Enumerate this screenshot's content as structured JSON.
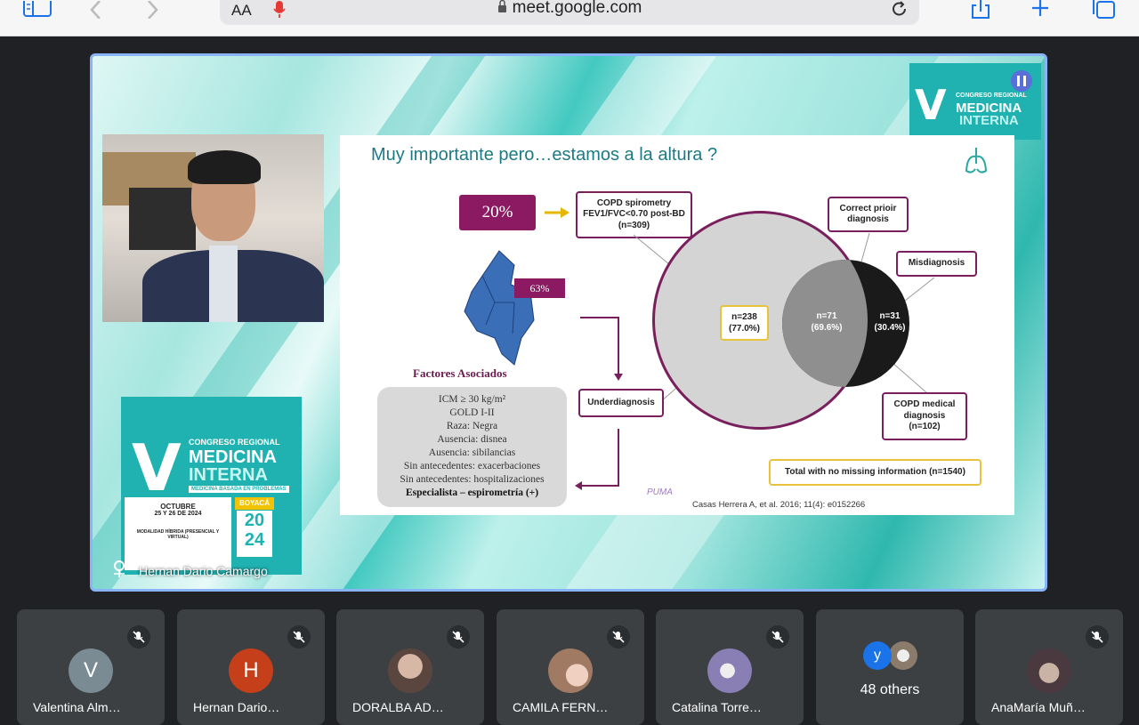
{
  "browser": {
    "text_size_label": "AA",
    "url": "meet.google.com",
    "icons": [
      "sidebar-icon",
      "back-icon",
      "forward-icon",
      "mic-icon",
      "lock-icon",
      "reload-icon",
      "share-icon",
      "new-tab-icon",
      "tabs-icon"
    ]
  },
  "presentation": {
    "slide_title": "Muy importante pero…estamos a la altura  ?",
    "badge_20": "20%",
    "badge_63": "63%",
    "copd_spirometry": "COPD spirometry\nFEV1/FVC<0.70 post-BD\n(n=309)",
    "correct_prior": "Correct prioir\ndiagnosis",
    "misdiagnosis": "Misdiagnosis",
    "underdiagnosis": "Underdiagnosis",
    "copd_medical": "COPD medical\ndiagnosis\n(n=102)",
    "n238": "n=238\n(77.0%)",
    "n71": "n=71\n(69.6%)",
    "n31": "n=31\n(30.4%)",
    "total": "Total with no missing information (n=1540)",
    "factors_title": "Factores Asociados",
    "factors": [
      "ICM ≥ 30 kg/m²",
      "GOLD I-II",
      "Raza: Negra",
      "Ausencia: disnea",
      "Ausencia: sibilancias",
      "Sin antecedentes: exacerbaciones",
      "Sin antecedentes: hospitalizaciones"
    ],
    "factors_last": "Especialista – espirometría (+)",
    "puma": "PUMA",
    "citation": "Casas Herrera A, et al. 2016; 11(4): e0152266",
    "congress_v": "V",
    "congress_line1": "CONGRESO REGIONAL",
    "congress_line2": "MEDICINA",
    "congress_line3": "INTERNA",
    "congress_sub": "MEDICINA BASADA EN PROBLEMAS",
    "congress_month": "OCTUBRE",
    "congress_dates": "25 Y 26 DE 2024",
    "congress_mode": "MODALIDAD HÍBRIDA (PRESENCIAL Y VIRTUAL)",
    "congress_city": "BOYACÁ",
    "congress_year_top": "20",
    "congress_year_bottom": "24",
    "presenter_name": "Hernan Dario Camargo"
  },
  "participants": [
    {
      "initial": "V",
      "name": "Valentina Alm…",
      "color": "#7b8b94"
    },
    {
      "initial": "H",
      "name": "Hernan Dario…",
      "color": "#c5401a"
    },
    {
      "initial": "",
      "name": "DORALBA AD…",
      "color": "#6b5a55"
    },
    {
      "initial": "",
      "name": "CAMILA FERN…",
      "color": "#8a6a52"
    },
    {
      "initial": "",
      "name": "Catalina Torre…",
      "color": "#6c6f8a"
    },
    {
      "initial": "",
      "name": "48 others",
      "color": ""
    },
    {
      "initial": "",
      "name": "AnaMaría Muñ…",
      "color": "#5d4a52"
    }
  ],
  "others_initial": "y"
}
